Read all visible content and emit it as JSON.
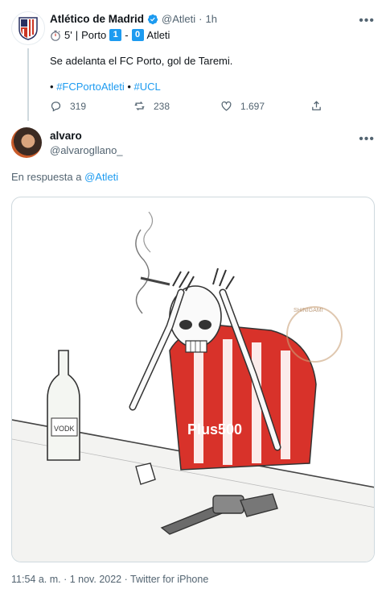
{
  "tweet": {
    "author_name": "Atlético de Madrid",
    "author_handle": "@Atleti",
    "separator": "·",
    "time_ago": "1h",
    "match": {
      "minute": "5'",
      "divider": "|",
      "home_team": "Porto",
      "home_score": "1",
      "score_sep": "-",
      "away_score": "0",
      "away_team": "Atleti"
    },
    "text": "Se adelanta el FC Porto, gol de Taremi.",
    "bullet": "•",
    "hashtags": [
      "#FCPortoAtleti",
      "#UCL"
    ],
    "stats": {
      "replies": "319",
      "retweets": "238",
      "likes": "1.697"
    }
  },
  "reply": {
    "author_name": "alvaro",
    "author_handle": "@alvarogllano_",
    "in_reply_prefix": "En respuesta a",
    "in_reply_handle": "@Atleti",
    "image": {
      "bottle_label": "VODK",
      "shirt_sponsor": "Plus500",
      "stamp_text": "SHINIGAMI"
    },
    "timestamp": "11:54 a. m. · 1 nov. 2022 · Twitter for iPhone"
  },
  "icons": {
    "club_logo": "atletico-crest-icon",
    "verified": "verified-badge-icon",
    "more": "more-options-icon",
    "stopwatch": "stopwatch-icon",
    "reply": "reply-icon",
    "retweet": "retweet-icon",
    "like": "heart-icon",
    "share": "share-icon"
  },
  "colors": {
    "accent": "#1d9bf0",
    "muted": "#536471",
    "text": "#0f1419"
  }
}
